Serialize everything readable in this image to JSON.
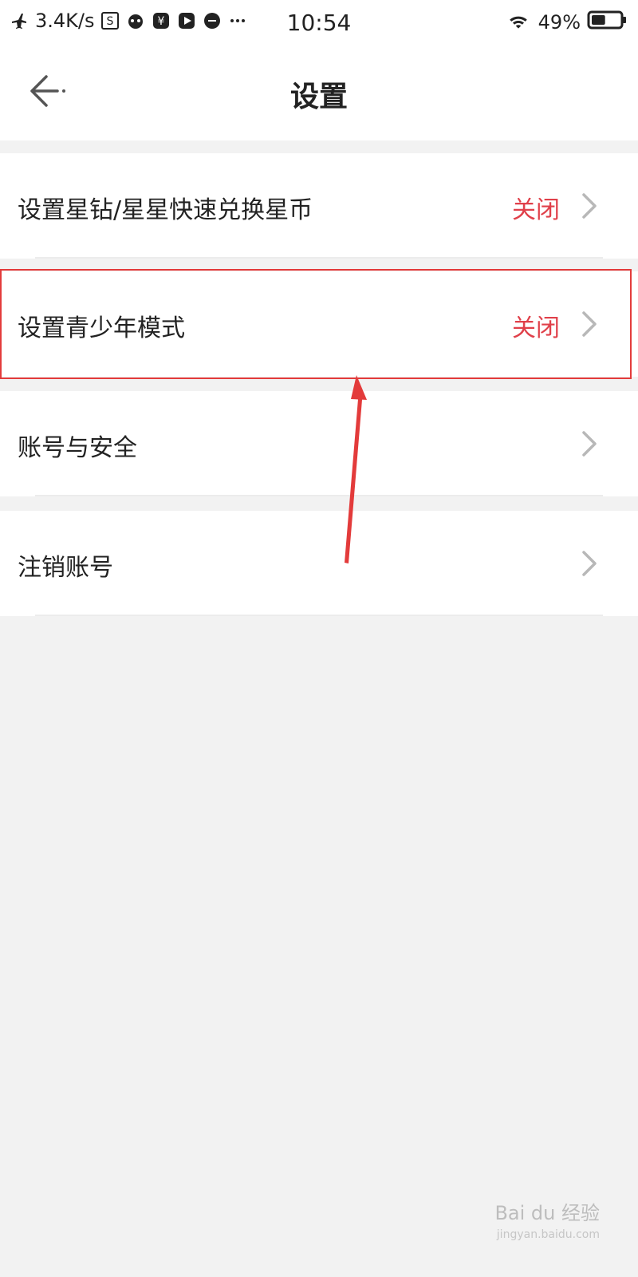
{
  "status_bar": {
    "speed": "3.4K/s",
    "time": "10:54",
    "battery": "49%",
    "battery_level": 0.49
  },
  "nav": {
    "title": "设置"
  },
  "rows": [
    {
      "label": "设置星钻/星星快速兑换星币",
      "value": "关闭"
    },
    {
      "label": "设置青少年模式",
      "value": "关闭"
    },
    {
      "label": "账号与安全",
      "value": ""
    },
    {
      "label": "注销账号",
      "value": ""
    }
  ],
  "watermark": {
    "brand": "Bai du 经验",
    "url": "jingyan.baidu.com"
  },
  "colors": {
    "accent": "#e0404a",
    "annotation": "#e33b3b"
  }
}
